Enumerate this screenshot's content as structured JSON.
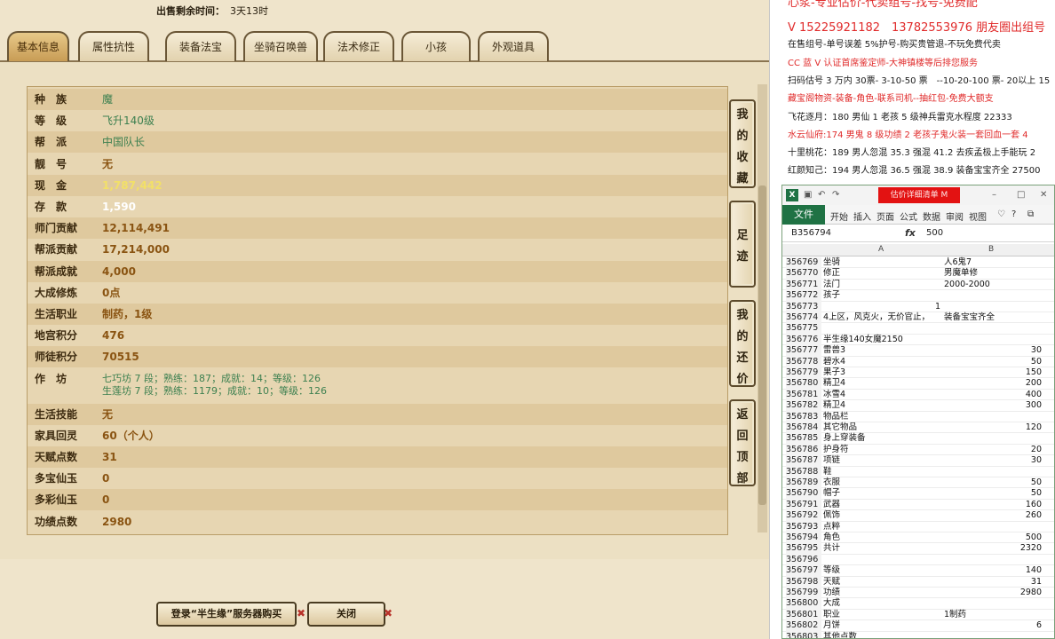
{
  "sale": {
    "label": "出售剩余时间：",
    "value": "3天13时"
  },
  "tabs": [
    "基本信息",
    "属性抗性",
    "装备法宝",
    "坐骑召唤兽",
    "法术修正",
    "小孩",
    "外观道具"
  ],
  "rows": [
    {
      "label": "种　族",
      "value": "魔",
      "style": "g"
    },
    {
      "label": "等　级",
      "value": "飞升140级",
      "style": "g"
    },
    {
      "label": "帮　派",
      "value": "中国队长",
      "style": "g"
    },
    {
      "label": "靓　号",
      "value": "无",
      "style": "o"
    },
    {
      "label": "现　金",
      "value": "1,787,442",
      "style": "y"
    },
    {
      "label": "存　款",
      "value": "1,590",
      "style": "w"
    },
    {
      "label": "师门贡献",
      "value": "12,114,491",
      "style": "o"
    },
    {
      "label": "帮派贡献",
      "value": "17,214,000",
      "style": "o"
    },
    {
      "label": "帮派成就",
      "value": "4,000",
      "style": "o"
    },
    {
      "label": "大成修炼",
      "value": "0点",
      "style": "o"
    },
    {
      "label": "生活职业",
      "value": "制药，1级",
      "style": "o"
    },
    {
      "label": "地宫积分",
      "value": "476",
      "style": "o"
    },
    {
      "label": "师徒积分",
      "value": "70515",
      "style": "o"
    },
    {
      "label": "作　坊",
      "value": "七巧坊 7 段；熟练：187；成就：14；等级：126",
      "value2": "生莲坊 7 段；熟练：1179；成就：10；等级：126",
      "style": "g",
      "tall": true
    },
    {
      "label": "生活技能",
      "value": "无",
      "style": "o"
    },
    {
      "label": "家具回灵",
      "value": "60（个人）",
      "style": "o"
    },
    {
      "label": "天赋点数",
      "value": "31",
      "style": "o"
    },
    {
      "label": "多宝仙玉",
      "value": "0",
      "style": "o"
    },
    {
      "label": "多彩仙玉",
      "value": "0",
      "style": "o"
    },
    {
      "label": "功绩点数",
      "value": "2980",
      "style": "o"
    }
  ],
  "side_buttons": [
    "我的收藏",
    "足迹",
    "我的还价",
    "返回顶部"
  ],
  "bottom_buttons": {
    "buy": "登录“半生缘”服务器购买",
    "close": "关闭"
  },
  "ads": [
    {
      "text": "心浆-专业估价-代卖组号-找号-免费配",
      "style": "red big"
    },
    {
      "text": "V 15225921182　13782553976 朋友圈出组号",
      "style": "red big"
    },
    {
      "text": "在售组号-单号误差 5%护号-购买贵管退-不玩免费代卖",
      "style": "blk"
    },
    {
      "text": "CC 蓝 V 认证首席鉴定师-大神镇楼等后排您服务",
      "style": "red"
    },
    {
      "text": "扫码估号 3 万内 30票- 3-10-50 票　--10-20-100 票- 20以上 15",
      "style": "blk"
    },
    {
      "text": "藏宝阁物资-装备-角色-联系司机--抽红包-免费大额支",
      "style": "red"
    },
    {
      "text": "飞花逐月：180 男仙 1 老孩 5 级神兵雷克水程度 22333",
      "style": "blk"
    },
    {
      "text": "水云仙府:174 男鬼 8 级功绩 2 老孩子鬼火装一套回血一套 4",
      "style": "red"
    },
    {
      "text": "十里桃花：189 男人忽混 35.3 强混 41.2 去疾孟极上手能玩 2",
      "style": "blk"
    },
    {
      "text": "红颜知己：194 男人忽混 36.5 强混 38.9 装备宝宝齐全 27500",
      "style": "blk"
    }
  ],
  "excel": {
    "logo": "X",
    "filename": "估价详细清单 M",
    "ribbon_tabs": [
      "开始",
      "插入",
      "页面",
      "公式",
      "数据",
      "审阅",
      "视图"
    ],
    "file_tab": "文件",
    "name_box": "B356794",
    "fx": "fx",
    "formula": "500",
    "col_a": "A",
    "col_b": "B",
    "rows": [
      {
        "n": "356769",
        "a": "坐骑",
        "b": "人6鬼7"
      },
      {
        "n": "356770",
        "a": "修正",
        "b": "男魔单修"
      },
      {
        "n": "356771",
        "a": "法门",
        "b": "2000-2000"
      },
      {
        "n": "356772",
        "a": "孩子",
        "b": ""
      },
      {
        "n": "356773",
        "an": "1",
        "b": ""
      },
      {
        "n": "356774",
        "a": "4上区，风克火，无价官止，",
        "b": "装备宝宝齐全"
      },
      {
        "n": "356775",
        "a": "",
        "b": ""
      },
      {
        "n": "356776",
        "a": "半生缘140女魔2150",
        "b": ""
      },
      {
        "n": "356777",
        "a": "雷兽3",
        "bn": "30"
      },
      {
        "n": "356778",
        "a": "碧水4",
        "bn": "50"
      },
      {
        "n": "356779",
        "a": "果子3",
        "bn": "150"
      },
      {
        "n": "356780",
        "a": "精卫4",
        "bn": "200"
      },
      {
        "n": "356781",
        "a": "冰雪4",
        "bn": "400"
      },
      {
        "n": "356782",
        "a": "精卫4",
        "bn": "300"
      },
      {
        "n": "356783",
        "a": "物品栏",
        "b": ""
      },
      {
        "n": "356784",
        "a": "其它物品",
        "bn": "120"
      },
      {
        "n": "356785",
        "a": "身上穿装备",
        "b": ""
      },
      {
        "n": "356786",
        "a": "护身符",
        "bn": "20"
      },
      {
        "n": "356787",
        "a": "项链",
        "bn": "30"
      },
      {
        "n": "356788",
        "a": "鞋",
        "b": ""
      },
      {
        "n": "356789",
        "a": "衣服",
        "bn": "50"
      },
      {
        "n": "356790",
        "a": "帽子",
        "bn": "50"
      },
      {
        "n": "356791",
        "a": "武器",
        "bn": "160"
      },
      {
        "n": "356792",
        "a": "佩饰",
        "bn": "260"
      },
      {
        "n": "356793",
        "a": "点粹",
        "b": ""
      },
      {
        "n": "356794",
        "a": "角色",
        "bn": "500"
      },
      {
        "n": "356795",
        "a": "共计",
        "bn": "2320"
      },
      {
        "n": "356796",
        "a": "",
        "b": ""
      },
      {
        "n": "356797",
        "a": "等级",
        "bn": "140"
      },
      {
        "n": "356798",
        "a": "天赋",
        "bn": "31"
      },
      {
        "n": "356799",
        "a": "功绩",
        "bn": "2980"
      },
      {
        "n": "356800",
        "a": "大成",
        "b": ""
      },
      {
        "n": "356801",
        "a": "职业",
        "b": "1制药"
      },
      {
        "n": "356802",
        "a": "月饼",
        "bn": "6"
      },
      {
        "n": "356803",
        "a": "其他点数",
        "b": ""
      }
    ]
  }
}
